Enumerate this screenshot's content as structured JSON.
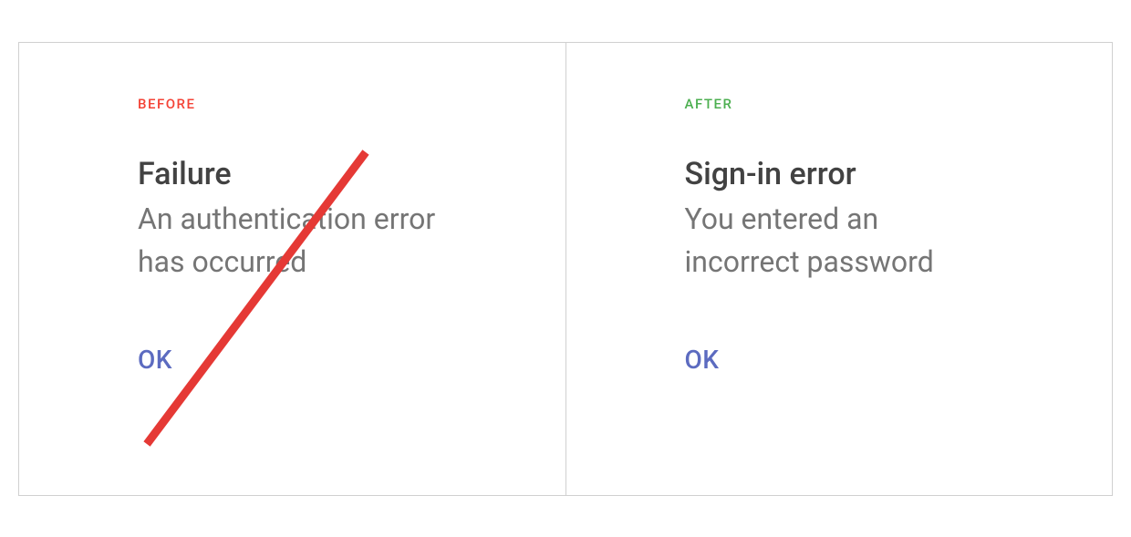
{
  "before": {
    "label": "BEFORE",
    "heading": "Failure",
    "body": "An authentication error has occurred",
    "button": "OK",
    "colors": {
      "label": "#f44336",
      "strike": "#e53935"
    }
  },
  "after": {
    "label": "AFTER",
    "heading": "Sign-in error",
    "body": "You entered an incorrect password",
    "button": "OK",
    "colors": {
      "label": "#4caf50"
    }
  },
  "common": {
    "button_color": "#5c6bc0",
    "heading_color": "#424242",
    "body_color": "#757575"
  }
}
